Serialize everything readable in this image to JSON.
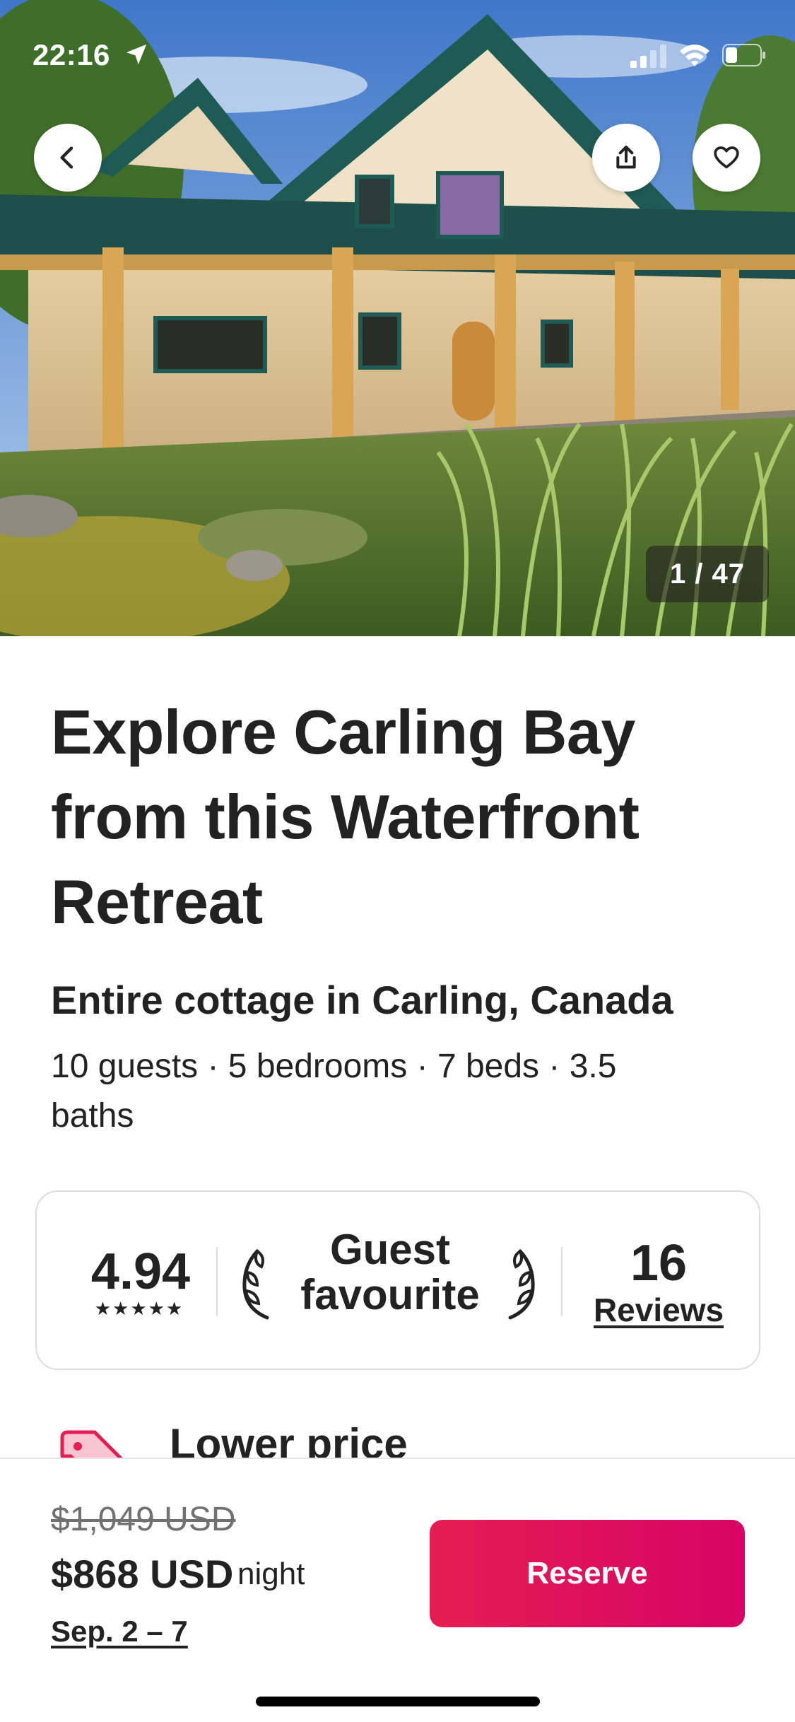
{
  "status_bar": {
    "time": "22:16",
    "icons": [
      "location-arrow-icon",
      "signal-icon",
      "wifi-icon",
      "battery-icon"
    ]
  },
  "hero": {
    "image": "waterfront cottage with timber-frame porch",
    "buttons": [
      "back-icon",
      "share-icon",
      "heart-icon"
    ],
    "photo_counter": "1 / 47"
  },
  "listing": {
    "title": "Explore Carling Bay from this Waterfront Retreat",
    "subtitle": "Entire cottage in Carling, Canada",
    "details": "10 guests · 5 bedrooms · 7 beds · 3.5 baths"
  },
  "rating_card": {
    "score": "4.94",
    "stars": "★★★★★",
    "badge": "Guest favourite",
    "badge_icon": "laurel-icon",
    "review_count": "16",
    "review_label": "Reviews"
  },
  "lower_price": {
    "icon": "price-tag-icon",
    "text": "Lower price"
  },
  "booking_bar": {
    "old_price": "$1,049 USD",
    "price": "$868 USD",
    "per": "night",
    "dates": "Sep. 2 – 7",
    "reserve_label": "Reserve"
  },
  "colors": {
    "accent": "#E51D52",
    "text": "#222222",
    "muted": "#717171",
    "border": "#DDDDDD"
  }
}
